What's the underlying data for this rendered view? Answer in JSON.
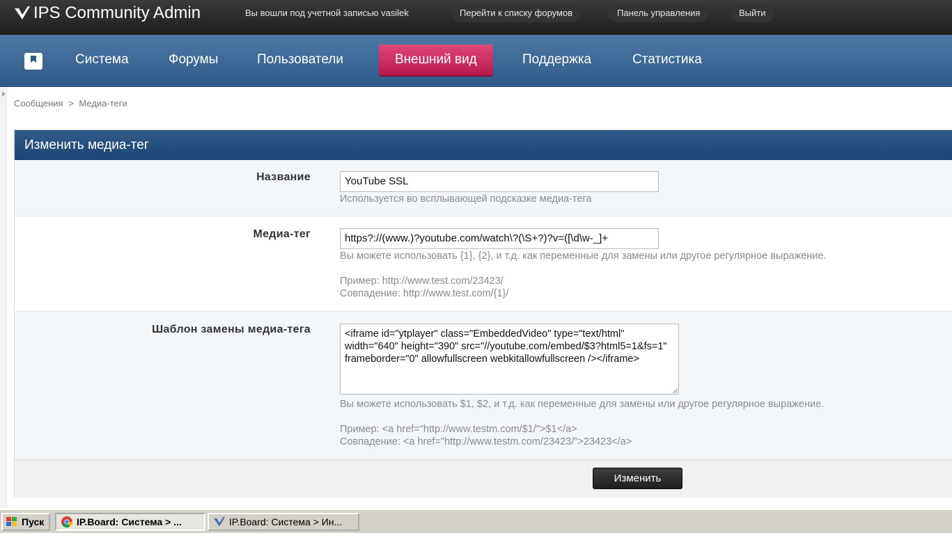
{
  "app": {
    "title": "IPS Community Admin",
    "logged_in_text": "Вы вошли под учетной записью vasilek",
    "top_links": [
      "Перейти к списку форумов",
      "Панель управления",
      "Выйти"
    ]
  },
  "nav": {
    "items": [
      "Система",
      "Форумы",
      "Пользователи",
      "Внешний вид",
      "Поддержка",
      "Статистика"
    ],
    "active": "Внешний вид"
  },
  "breadcrumb": {
    "items": [
      "Сообщения",
      "Медиа-теги"
    ],
    "separator": ">"
  },
  "form": {
    "title": "Изменить медиа-тег",
    "fields": {
      "name": {
        "label": "Название",
        "value": "YouTube SSL",
        "hint": "Используется во всплывающей подсказке медиа-тега"
      },
      "tag": {
        "label": "Медиа-тег",
        "value": "https?://(www.)?youtube.com/watch\\?(\\S+?)?v=([\\d\\w-_]+",
        "hint": "Вы можете использовать {1}, {2}, и т.д. как переменные для замены или другое регулярное выражение.",
        "example": "Пример: http://www.test.com/23423/",
        "match": "Совпадение: http://www.test.com/{1}/"
      },
      "template": {
        "label": "Шаблон замены медиа-тега",
        "value": "<iframe id=\"ytplayer\" class=\"EmbeddedVideo\" type=\"text/html\" width=\"640\" height=\"390\" src=\"//youtube.com/embed/$3?html5=1&fs=1\" frameborder=\"0\" allowfullscreen webkitallowfullscreen /></iframe>",
        "hint": "Вы можете использовать $1, $2, и т.д. как переменные для замены или другое регулярное выражение.",
        "example": "Пример: <a href=\"http://www.testm.com/$1/\">$1</a>",
        "match": "Совпадение: <a href=\"http://www.testm.com/23423/\">23423</a>"
      }
    },
    "submit_label": "Изменить"
  },
  "taskbar": {
    "start_label": "Пуск",
    "tasks": [
      "IP.Board: Система > ...",
      "IP.Board: Система > Ин..."
    ]
  },
  "colors": {
    "nav_bg": "#3b6793",
    "nav_active": "#d12f63",
    "panel_header": "#274f7e",
    "topbar_bg": "#262626"
  }
}
